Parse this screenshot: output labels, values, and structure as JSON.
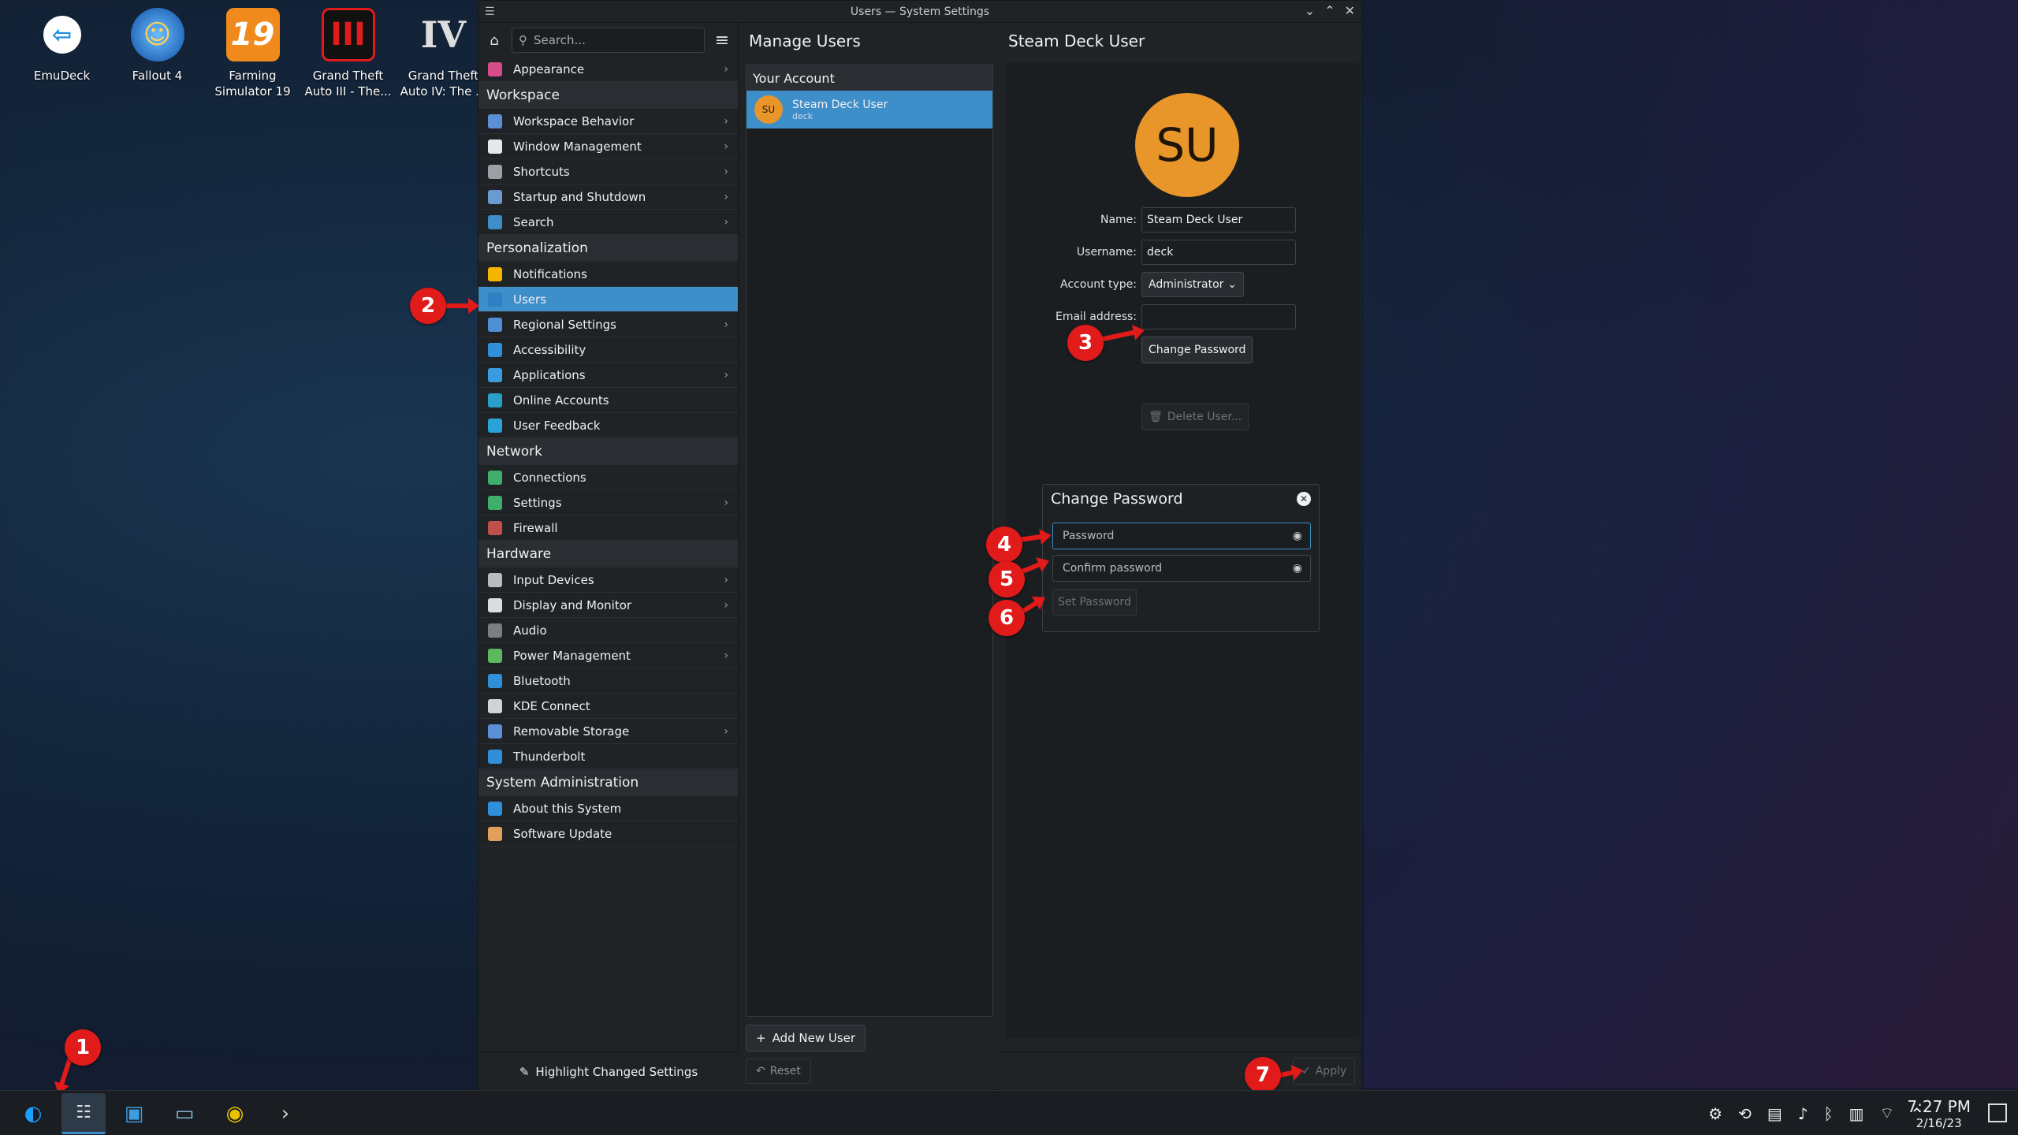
{
  "desktop_icons": [
    {
      "label": "EmuDeck",
      "glyph": "⇦"
    },
    {
      "label": "Fallout 4",
      "glyph": "☺"
    },
    {
      "label": "Farming Simulator 19",
      "glyph": "19"
    },
    {
      "label": "Grand Theft Auto III - The...",
      "glyph": "III"
    },
    {
      "label": "Grand Theft Auto IV: The ...",
      "glyph": "IV"
    }
  ],
  "window": {
    "title": "Users — System Settings"
  },
  "sidebar": {
    "search_placeholder": "Search...",
    "footer_label": "Highlight Changed Settings",
    "top_items": [
      {
        "label": "Appearance",
        "color": "#d64d8a",
        "chevron": true
      }
    ],
    "categories": [
      {
        "title": "Workspace",
        "items": [
          {
            "label": "Workspace Behavior",
            "color": "#5b8fd6",
            "chevron": true
          },
          {
            "label": "Window Management",
            "color": "#e8e8e8",
            "chevron": true
          },
          {
            "label": "Shortcuts",
            "color": "#9aa0a6",
            "chevron": true
          },
          {
            "label": "Startup and Shutdown",
            "color": "#6a9ad0",
            "chevron": true
          },
          {
            "label": "Search",
            "color": "#3d8ec9",
            "chevron": true
          }
        ]
      },
      {
        "title": "Personalization",
        "items": [
          {
            "label": "Notifications",
            "color": "#f4b400",
            "chevron": false
          },
          {
            "label": "Users",
            "color": "#2f7fc4",
            "chevron": false,
            "selected": true
          },
          {
            "label": "Regional Settings",
            "color": "#4f8fd6",
            "chevron": true
          },
          {
            "label": "Accessibility",
            "color": "#2f8fd8",
            "chevron": false
          },
          {
            "label": "Applications",
            "color": "#3b9be0",
            "chevron": true
          },
          {
            "label": "Online Accounts",
            "color": "#2aa0c8",
            "chevron": false
          },
          {
            "label": "User Feedback",
            "color": "#29a3d8",
            "chevron": false
          }
        ]
      },
      {
        "title": "Network",
        "items": [
          {
            "label": "Connections",
            "color": "#3fae6a",
            "chevron": false
          },
          {
            "label": "Settings",
            "color": "#3fae6a",
            "chevron": true
          },
          {
            "label": "Firewall",
            "color": "#c0504d",
            "chevron": false
          }
        ]
      },
      {
        "title": "Hardware",
        "items": [
          {
            "label": "Input Devices",
            "color": "#b8bcc0",
            "chevron": true
          },
          {
            "label": "Display and Monitor",
            "color": "#dcdcdc",
            "chevron": true
          },
          {
            "label": "Audio",
            "color": "#7a7f84",
            "chevron": false
          },
          {
            "label": "Power Management",
            "color": "#5cb85c",
            "chevron": true
          },
          {
            "label": "Bluetooth",
            "color": "#2f8fd8",
            "chevron": false
          },
          {
            "label": "KDE Connect",
            "color": "#cfd3d6",
            "chevron": false
          },
          {
            "label": "Removable Storage",
            "color": "#5b8fd6",
            "chevron": true
          },
          {
            "label": "Thunderbolt",
            "color": "#2f8fd8",
            "chevron": false
          }
        ]
      },
      {
        "title": "System Administration",
        "items": [
          {
            "label": "About this System",
            "color": "#2f8fd8",
            "chevron": false
          },
          {
            "label": "Software Update",
            "color": "#e0a05a",
            "chevron": false
          }
        ]
      }
    ]
  },
  "manage": {
    "heading": "Manage Users",
    "your_account": "Your Account",
    "account": {
      "initials": "SU",
      "name": "Steam Deck User",
      "username": "deck"
    },
    "add_user": "Add New User",
    "reset": "Reset"
  },
  "detail": {
    "heading": "Steam Deck User",
    "initials": "SU",
    "name_label": "Name:",
    "name_value": "Steam Deck User",
    "username_label": "Username:",
    "username_value": "deck",
    "account_type_label": "Account type:",
    "account_type_value": "Administrator",
    "email_label": "Email address:",
    "email_value": "",
    "change_password": "Change Password",
    "delete_user": "Delete User...",
    "apply": "Apply"
  },
  "change_password_dialog": {
    "title": "Change Password",
    "password_placeholder": "Password",
    "confirm_placeholder": "Confirm password",
    "set_password": "Set Password"
  },
  "annotations": [
    "1",
    "2",
    "3",
    "4",
    "5",
    "6",
    "7"
  ],
  "taskbar": {
    "time": "7:27 PM",
    "date": "2/16/23"
  }
}
